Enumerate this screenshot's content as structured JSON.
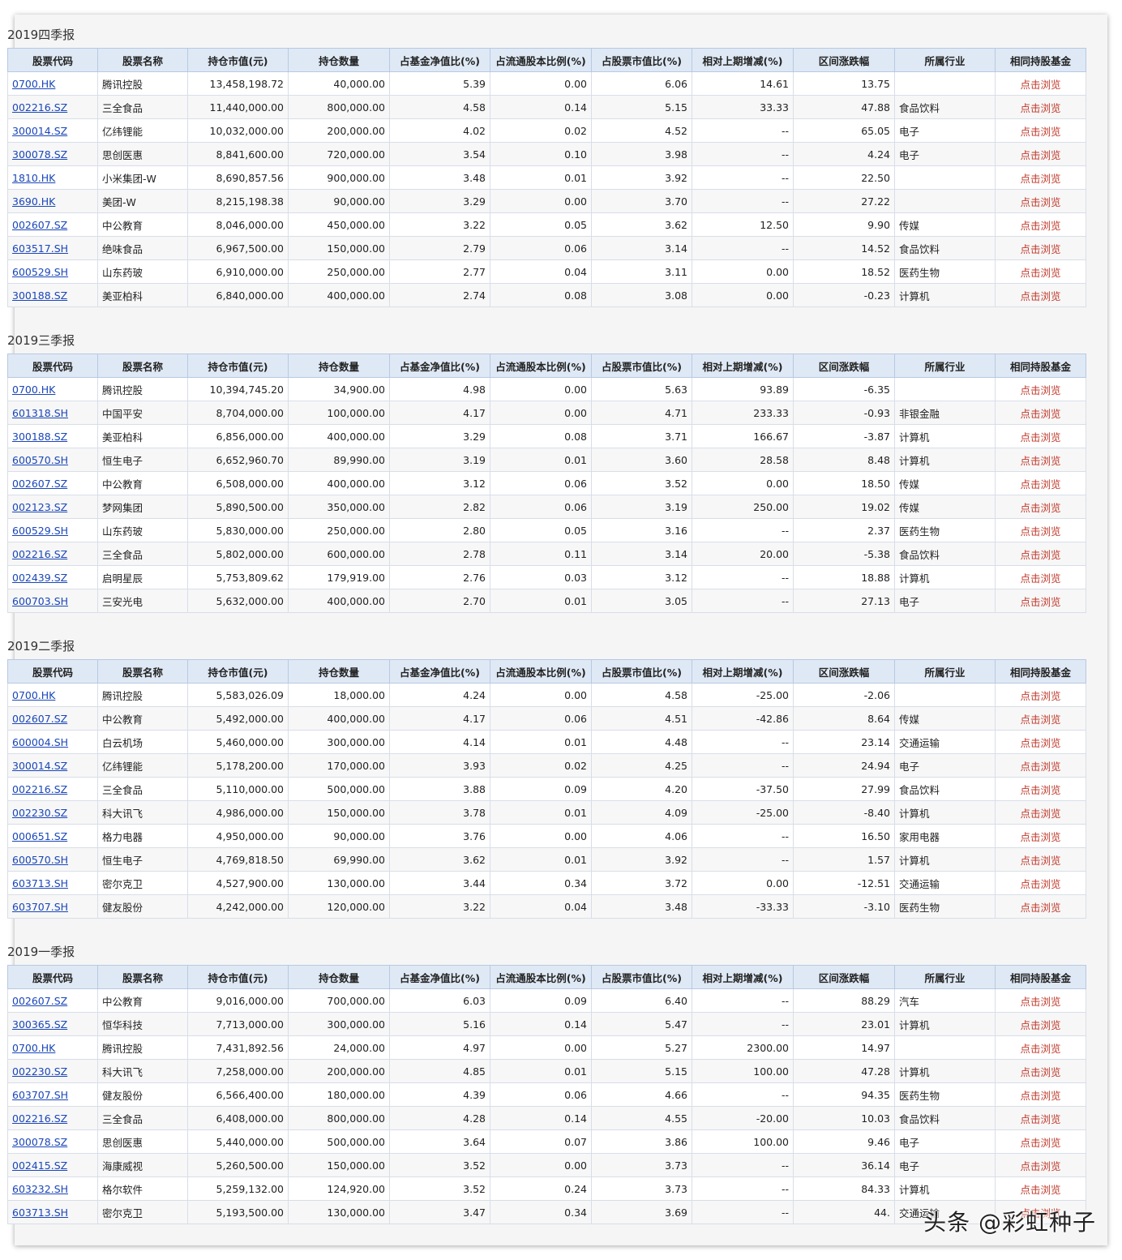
{
  "columns": [
    "股票代码",
    "股票名称",
    "持仓市值(元)",
    "持仓数量",
    "占基金净值比(%)",
    "占流通股本比例(%)",
    "占股票市值比(%)",
    "相对上期增减(%)",
    "区间涨跌幅",
    "所属行业",
    "相同持股基金"
  ],
  "sections": [
    {
      "title": "2019四季报",
      "rows": [
        [
          "0700.HK",
          "腾讯控股",
          "13,458,198.72",
          "40,000.00",
          "5.39",
          "0.00",
          "6.06",
          "14.61",
          "13.75",
          "",
          "点击浏览"
        ],
        [
          "002216.SZ",
          "三全食品",
          "11,440,000.00",
          "800,000.00",
          "4.58",
          "0.14",
          "5.15",
          "33.33",
          "47.88",
          "食品饮料",
          "点击浏览"
        ],
        [
          "300014.SZ",
          "亿纬锂能",
          "10,032,000.00",
          "200,000.00",
          "4.02",
          "0.02",
          "4.52",
          "--",
          "65.05",
          "电子",
          "点击浏览"
        ],
        [
          "300078.SZ",
          "思创医惠",
          "8,841,600.00",
          "720,000.00",
          "3.54",
          "0.10",
          "3.98",
          "--",
          "4.24",
          "电子",
          "点击浏览"
        ],
        [
          "1810.HK",
          "小米集团-W",
          "8,690,857.56",
          "900,000.00",
          "3.48",
          "0.01",
          "3.92",
          "--",
          "22.50",
          "",
          "点击浏览"
        ],
        [
          "3690.HK",
          "美团-W",
          "8,215,198.38",
          "90,000.00",
          "3.29",
          "0.00",
          "3.70",
          "--",
          "27.22",
          "",
          "点击浏览"
        ],
        [
          "002607.SZ",
          "中公教育",
          "8,046,000.00",
          "450,000.00",
          "3.22",
          "0.05",
          "3.62",
          "12.50",
          "9.90",
          "传媒",
          "点击浏览"
        ],
        [
          "603517.SH",
          "绝味食品",
          "6,967,500.00",
          "150,000.00",
          "2.79",
          "0.06",
          "3.14",
          "--",
          "14.52",
          "食品饮料",
          "点击浏览"
        ],
        [
          "600529.SH",
          "山东药玻",
          "6,910,000.00",
          "250,000.00",
          "2.77",
          "0.04",
          "3.11",
          "0.00",
          "18.52",
          "医药生物",
          "点击浏览"
        ],
        [
          "300188.SZ",
          "美亚柏科",
          "6,840,000.00",
          "400,000.00",
          "2.74",
          "0.08",
          "3.08",
          "0.00",
          "-0.23",
          "计算机",
          "点击浏览"
        ]
      ]
    },
    {
      "title": "2019三季报",
      "rows": [
        [
          "0700.HK",
          "腾讯控股",
          "10,394,745.20",
          "34,900.00",
          "4.98",
          "0.00",
          "5.63",
          "93.89",
          "-6.35",
          "",
          "点击浏览"
        ],
        [
          "601318.SH",
          "中国平安",
          "8,704,000.00",
          "100,000.00",
          "4.17",
          "0.00",
          "4.71",
          "233.33",
          "-0.93",
          "非银金融",
          "点击浏览"
        ],
        [
          "300188.SZ",
          "美亚柏科",
          "6,856,000.00",
          "400,000.00",
          "3.29",
          "0.08",
          "3.71",
          "166.67",
          "-3.87",
          "计算机",
          "点击浏览"
        ],
        [
          "600570.SH",
          "恒生电子",
          "6,652,960.70",
          "89,990.00",
          "3.19",
          "0.01",
          "3.60",
          "28.58",
          "8.48",
          "计算机",
          "点击浏览"
        ],
        [
          "002607.SZ",
          "中公教育",
          "6,508,000.00",
          "400,000.00",
          "3.12",
          "0.06",
          "3.52",
          "0.00",
          "18.50",
          "传媒",
          "点击浏览"
        ],
        [
          "002123.SZ",
          "梦网集团",
          "5,890,500.00",
          "350,000.00",
          "2.82",
          "0.06",
          "3.19",
          "250.00",
          "19.02",
          "传媒",
          "点击浏览"
        ],
        [
          "600529.SH",
          "山东药玻",
          "5,830,000.00",
          "250,000.00",
          "2.80",
          "0.05",
          "3.16",
          "--",
          "2.37",
          "医药生物",
          "点击浏览"
        ],
        [
          "002216.SZ",
          "三全食品",
          "5,802,000.00",
          "600,000.00",
          "2.78",
          "0.11",
          "3.14",
          "20.00",
          "-5.38",
          "食品饮料",
          "点击浏览"
        ],
        [
          "002439.SZ",
          "启明星辰",
          "5,753,809.62",
          "179,919.00",
          "2.76",
          "0.03",
          "3.12",
          "--",
          "18.88",
          "计算机",
          "点击浏览"
        ],
        [
          "600703.SH",
          "三安光电",
          "5,632,000.00",
          "400,000.00",
          "2.70",
          "0.01",
          "3.05",
          "--",
          "27.13",
          "电子",
          "点击浏览"
        ]
      ]
    },
    {
      "title": "2019二季报",
      "rows": [
        [
          "0700.HK",
          "腾讯控股",
          "5,583,026.09",
          "18,000.00",
          "4.24",
          "0.00",
          "4.58",
          "-25.00",
          "-2.06",
          "",
          "点击浏览"
        ],
        [
          "002607.SZ",
          "中公教育",
          "5,492,000.00",
          "400,000.00",
          "4.17",
          "0.06",
          "4.51",
          "-42.86",
          "8.64",
          "传媒",
          "点击浏览"
        ],
        [
          "600004.SH",
          "白云机场",
          "5,460,000.00",
          "300,000.00",
          "4.14",
          "0.01",
          "4.48",
          "--",
          "23.14",
          "交通运输",
          "点击浏览"
        ],
        [
          "300014.SZ",
          "亿纬锂能",
          "5,178,200.00",
          "170,000.00",
          "3.93",
          "0.02",
          "4.25",
          "--",
          "24.94",
          "电子",
          "点击浏览"
        ],
        [
          "002216.SZ",
          "三全食品",
          "5,110,000.00",
          "500,000.00",
          "3.88",
          "0.09",
          "4.20",
          "-37.50",
          "27.99",
          "食品饮料",
          "点击浏览"
        ],
        [
          "002230.SZ",
          "科大讯飞",
          "4,986,000.00",
          "150,000.00",
          "3.78",
          "0.01",
          "4.09",
          "-25.00",
          "-8.40",
          "计算机",
          "点击浏览"
        ],
        [
          "000651.SZ",
          "格力电器",
          "4,950,000.00",
          "90,000.00",
          "3.76",
          "0.00",
          "4.06",
          "--",
          "16.50",
          "家用电器",
          "点击浏览"
        ],
        [
          "600570.SH",
          "恒生电子",
          "4,769,818.50",
          "69,990.00",
          "3.62",
          "0.01",
          "3.92",
          "--",
          "1.57",
          "计算机",
          "点击浏览"
        ],
        [
          "603713.SH",
          "密尔克卫",
          "4,527,900.00",
          "130,000.00",
          "3.44",
          "0.34",
          "3.72",
          "0.00",
          "-12.51",
          "交通运输",
          "点击浏览"
        ],
        [
          "603707.SH",
          "健友股份",
          "4,242,000.00",
          "120,000.00",
          "3.22",
          "0.04",
          "3.48",
          "-33.33",
          "-3.10",
          "医药生物",
          "点击浏览"
        ]
      ]
    },
    {
      "title": "2019一季报",
      "rows": [
        [
          "002607.SZ",
          "中公教育",
          "9,016,000.00",
          "700,000.00",
          "6.03",
          "0.09",
          "6.40",
          "--",
          "88.29",
          "汽车",
          "点击浏览"
        ],
        [
          "300365.SZ",
          "恒华科技",
          "7,713,000.00",
          "300,000.00",
          "5.16",
          "0.14",
          "5.47",
          "--",
          "23.01",
          "计算机",
          "点击浏览"
        ],
        [
          "0700.HK",
          "腾讯控股",
          "7,431,892.56",
          "24,000.00",
          "4.97",
          "0.00",
          "5.27",
          "2300.00",
          "14.97",
          "",
          "点击浏览"
        ],
        [
          "002230.SZ",
          "科大讯飞",
          "7,258,000.00",
          "200,000.00",
          "4.85",
          "0.01",
          "5.15",
          "100.00",
          "47.28",
          "计算机",
          "点击浏览"
        ],
        [
          "603707.SH",
          "健友股份",
          "6,566,400.00",
          "180,000.00",
          "4.39",
          "0.06",
          "4.66",
          "--",
          "94.35",
          "医药生物",
          "点击浏览"
        ],
        [
          "002216.SZ",
          "三全食品",
          "6,408,000.00",
          "800,000.00",
          "4.28",
          "0.14",
          "4.55",
          "-20.00",
          "10.03",
          "食品饮料",
          "点击浏览"
        ],
        [
          "300078.SZ",
          "思创医惠",
          "5,440,000.00",
          "500,000.00",
          "3.64",
          "0.07",
          "3.86",
          "100.00",
          "9.46",
          "电子",
          "点击浏览"
        ],
        [
          "002415.SZ",
          "海康威视",
          "5,260,500.00",
          "150,000.00",
          "3.52",
          "0.00",
          "3.73",
          "--",
          "36.14",
          "电子",
          "点击浏览"
        ],
        [
          "603232.SH",
          "格尔软件",
          "5,259,132.00",
          "124,920.00",
          "3.52",
          "0.24",
          "3.73",
          "--",
          "84.33",
          "计算机",
          "点击浏览"
        ],
        [
          "603713.SH",
          "密尔克卫",
          "5,193,500.00",
          "130,000.00",
          "3.47",
          "0.34",
          "3.69",
          "--",
          "44.",
          "交通运输",
          "点击浏览"
        ]
      ]
    }
  ],
  "watermark": "头条 @彩虹种子"
}
